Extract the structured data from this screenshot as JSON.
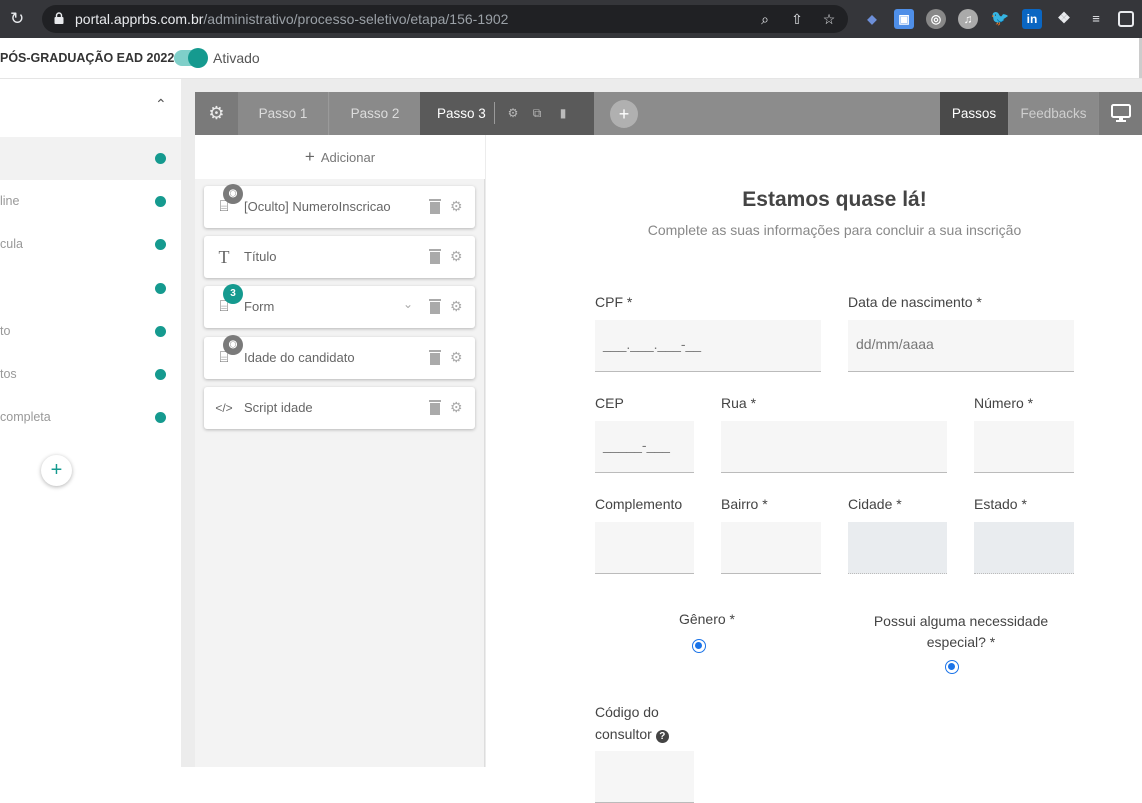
{
  "browser": {
    "url_host": "portal.apprbs.com.br",
    "url_path": "/administrativo/processo-seletivo/etapa/156-1902"
  },
  "header": {
    "title": "PÓS-GRADUAÇÃO EAD 2022",
    "toggle_label": "Ativado",
    "toggle_on": true
  },
  "sidebar": {
    "items": [
      {
        "label": ""
      },
      {
        "label": "line"
      },
      {
        "label": "cula"
      },
      {
        "label": ""
      },
      {
        "label": "to"
      },
      {
        "label": "tos"
      },
      {
        "label": " completa"
      }
    ],
    "dot_color": "#159a8f"
  },
  "steps": {
    "items": [
      "Passo 1",
      "Passo 2",
      "Passo 3"
    ],
    "active": "Passo 3",
    "tabs": [
      "Passos",
      "Feedbacks"
    ]
  },
  "components": {
    "add_label": "Adicionar",
    "items": [
      {
        "label": "[Oculto] NumeroInscricao",
        "icon": "monitor-pin-icon",
        "badge": "hidden"
      },
      {
        "label": "Título",
        "icon": "text-icon",
        "badge": ""
      },
      {
        "label": "Form",
        "icon": "form-icon",
        "badge": "3"
      },
      {
        "label": "Idade do candidato",
        "icon": "monitor-pin-icon",
        "badge": "hidden"
      },
      {
        "label": "Script idade",
        "icon": "code-icon",
        "badge": ""
      }
    ]
  },
  "preview": {
    "title": "Estamos quase lá!",
    "subtitle": "Complete as suas informações para concluir a sua inscrição",
    "fields": {
      "cpf_label": "CPF *",
      "cpf_placeholder": "___.___.___-__",
      "dob_label": "Data de nascimento *",
      "dob_placeholder": "dd/mm/aaaa",
      "cep_label": "CEP",
      "cep_placeholder": "_____-___",
      "rua_label": "Rua *",
      "numero_label": "Número *",
      "complemento_label": "Complemento",
      "bairro_label": "Bairro *",
      "cidade_label": "Cidade *",
      "estado_label": "Estado *",
      "genero_label": "Gênero *",
      "necessidade_label": "Possui alguma necessidade especial? *",
      "codigo_label_1": "Código do",
      "codigo_label_2": "consultor"
    }
  }
}
